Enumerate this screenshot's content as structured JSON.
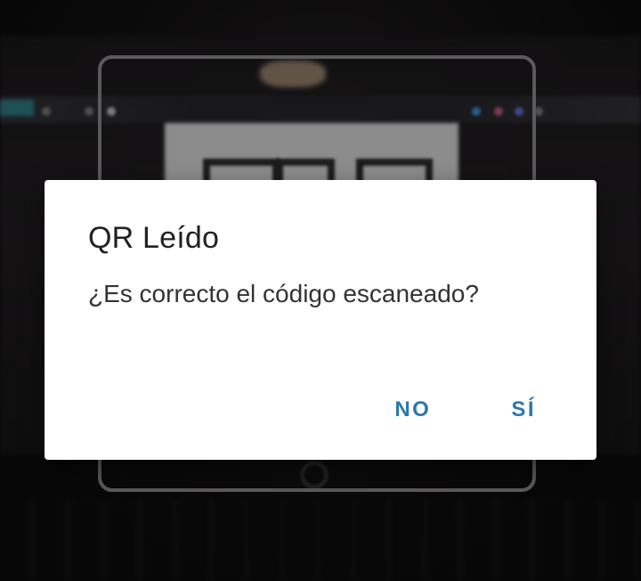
{
  "dialog": {
    "title": "QR Leído",
    "message": "¿Es correcto el código escaneado?",
    "buttons": {
      "no_label": "NO",
      "yes_label": "SÍ"
    },
    "accent_color": "#2b78b0"
  }
}
